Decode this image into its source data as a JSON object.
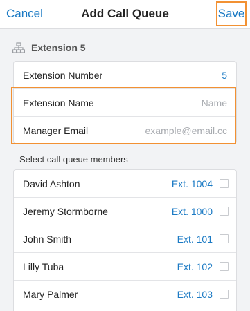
{
  "header": {
    "cancel_label": "Cancel",
    "title": "Add Call Queue",
    "save_label": "Save"
  },
  "section": {
    "icon": "extension-hierarchy-icon",
    "title": "Extension 5"
  },
  "form": {
    "extension_number_label": "Extension Number",
    "extension_number_value": "5",
    "extension_name_label": "Extension Name",
    "extension_name_value": "",
    "extension_name_placeholder": "Name",
    "manager_email_label": "Manager Email",
    "manager_email_value": "",
    "manager_email_placeholder": "example@email.cc"
  },
  "members_caption": "Select call queue members",
  "members": [
    {
      "name": "David Ashton",
      "ext": "Ext. 1004",
      "checked": false
    },
    {
      "name": "Jeremy Stormborne",
      "ext": "Ext. 1000",
      "checked": false
    },
    {
      "name": "John Smith",
      "ext": "Ext. 101",
      "checked": false
    },
    {
      "name": "Lilly Tuba",
      "ext": "Ext. 102",
      "checked": false
    },
    {
      "name": "Mary Palmer",
      "ext": "Ext. 103",
      "checked": false
    }
  ],
  "colors": {
    "accent": "#1b7ac4",
    "highlight": "#f29133",
    "background": "#f2f3f5"
  }
}
